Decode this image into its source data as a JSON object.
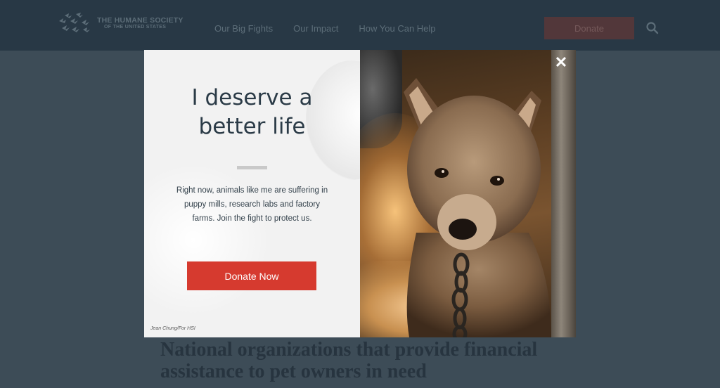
{
  "header": {
    "logo_line1": "THE HUMANE SOCIETY",
    "logo_line2": "OF THE UNITED STATES",
    "nav": [
      "Our Big Fights",
      "Our Impact",
      "How You Can Help"
    ],
    "donate_label": "Donate",
    "search_icon": "search-icon"
  },
  "page": {
    "heading": "National organizations that provide financial assistance to pet owners in need"
  },
  "modal": {
    "title_line1": "I deserve a",
    "title_line2": "better life",
    "copy": "Right now, animals like me are suffering in puppy mills, research labs and factory farms. Join the fight to protect us.",
    "button_label": "Donate Now",
    "photo_credit": "Jean Chung/For HSI",
    "close_icon": "close-icon",
    "close_glyph": "✕"
  },
  "colors": {
    "accent_red": "#d63a2f",
    "header_bg": "#283845",
    "overlay_bg": "#3d4c57",
    "title_text": "#2b3b47"
  }
}
